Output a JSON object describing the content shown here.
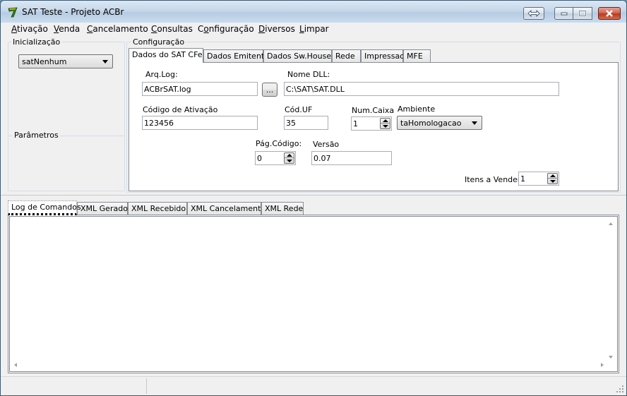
{
  "window": {
    "title": "SAT Teste - Projeto ACBr"
  },
  "menu": [
    {
      "label": "Ativação",
      "accel": "A",
      "rest": "tivação"
    },
    {
      "label": "Venda",
      "accel": "V",
      "rest": "enda"
    },
    {
      "label": "Cancelamento",
      "accel": "C",
      "rest": "ancelamento"
    },
    {
      "label": "Consultas",
      "accel": "C",
      "rest": "onsultas"
    },
    {
      "label": "Configuração",
      "accel": "o",
      "pre": "C",
      "rest": "nfiguração"
    },
    {
      "label": "Diversos",
      "accel": "D",
      "rest": "iversos"
    },
    {
      "label": "Limpar",
      "accel": "L",
      "rest": "impar"
    }
  ],
  "left": {
    "init_label": "Inicialização",
    "model_value": "satNenhum",
    "params_label": "Parâmetros"
  },
  "config": {
    "label": "Configuração",
    "tabs": [
      "Dados do SAT CFe",
      "Dados Emitente",
      "Dados Sw.House",
      "Rede",
      "Impressao",
      "MFE"
    ],
    "arq_log_label": "Arq.Log:",
    "arq_log_value": "ACBrSAT.log",
    "browse_label": "...",
    "nome_dll_label": "Nome DLL:",
    "nome_dll_value": "C:\\SAT\\SAT.DLL",
    "cod_ativacao_label": "Código de Ativação",
    "cod_ativacao_value": "123456",
    "cod_uf_label": "Cód.UF",
    "cod_uf_value": "35",
    "num_caixa_label": "Num.Caixa",
    "num_caixa_value": "1",
    "ambiente_label": "Ambiente",
    "ambiente_value": "taHomologacao",
    "pag_codigo_label": "Pág.Código:",
    "pag_codigo_value": "0",
    "versao_label": "Versão",
    "versao_value": "0.07",
    "itens_label": "Itens a Vender",
    "itens_value": "1"
  },
  "log_tabs": [
    "Log de Comandos",
    "XML Gerado",
    "XML Recebido",
    "XML Cancelamento",
    "XML Rede"
  ]
}
